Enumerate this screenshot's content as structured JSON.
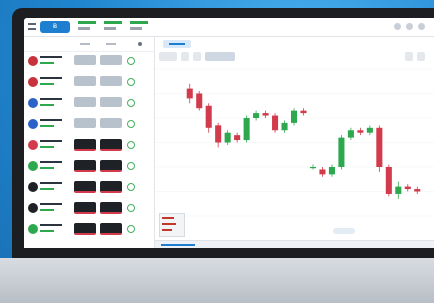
{
  "colors": {
    "accent": "#1e7fd0",
    "up": "#2ea84f",
    "down": "#d23b4b",
    "sell_button": "#b8c2cc",
    "buy_button_dark": "#1e2226"
  },
  "header": {
    "logo_text": "Ƀ"
  },
  "watchlist": {
    "rows": [
      {
        "color": "#c8323c",
        "dark": false
      },
      {
        "color": "#c8323c",
        "dark": false
      },
      {
        "color": "#2a62c9",
        "dark": false
      },
      {
        "color": "#2a62c9",
        "dark": false
      },
      {
        "color": "#d23b4b",
        "dark": true
      },
      {
        "color": "#2ea84f",
        "dark": true
      },
      {
        "color": "#1e2226",
        "dark": true
      },
      {
        "color": "#1e2226",
        "dark": true
      },
      {
        "color": "#2ea84f",
        "dark": true
      }
    ]
  },
  "chart_data": {
    "type": "candlestick",
    "candles": [
      {
        "o": 62,
        "c": 58,
        "h": 64,
        "l": 56
      },
      {
        "o": 60,
        "c": 54,
        "h": 61,
        "l": 53
      },
      {
        "o": 55,
        "c": 46,
        "h": 56,
        "l": 44
      },
      {
        "o": 47,
        "c": 40,
        "h": 48,
        "l": 38
      },
      {
        "o": 40,
        "c": 44,
        "h": 45,
        "l": 39
      },
      {
        "o": 43,
        "c": 41,
        "h": 44,
        "l": 40
      },
      {
        "o": 41,
        "c": 50,
        "h": 51,
        "l": 40
      },
      {
        "o": 50,
        "c": 52,
        "h": 53,
        "l": 49
      },
      {
        "o": 52,
        "c": 51,
        "h": 53,
        "l": 50
      },
      {
        "o": 51,
        "c": 45,
        "h": 52,
        "l": 44
      },
      {
        "o": 45,
        "c": 48,
        "h": 49,
        "l": 44
      },
      {
        "o": 48,
        "c": 53,
        "h": 54,
        "l": 47
      },
      {
        "o": 53,
        "c": 52,
        "h": 54,
        "l": 51
      },
      {
        "o": 30,
        "c": 30,
        "h": 31,
        "l": 29
      },
      {
        "o": 29,
        "c": 27,
        "h": 30,
        "l": 26
      },
      {
        "o": 27,
        "c": 30,
        "h": 31,
        "l": 26
      },
      {
        "o": 30,
        "c": 42,
        "h": 43,
        "l": 29
      },
      {
        "o": 42,
        "c": 45,
        "h": 46,
        "l": 41
      },
      {
        "o": 45,
        "c": 44,
        "h": 46,
        "l": 43
      },
      {
        "o": 44,
        "c": 46,
        "h": 47,
        "l": 43
      },
      {
        "o": 46,
        "c": 30,
        "h": 47,
        "l": 28
      },
      {
        "o": 30,
        "c": 19,
        "h": 31,
        "l": 18
      },
      {
        "o": 19,
        "c": 22,
        "h": 24,
        "l": 17
      },
      {
        "o": 22,
        "c": 21,
        "h": 23,
        "l": 20
      },
      {
        "o": 21,
        "c": 20,
        "h": 22,
        "l": 19
      }
    ],
    "ylim": [
      10,
      70
    ]
  }
}
